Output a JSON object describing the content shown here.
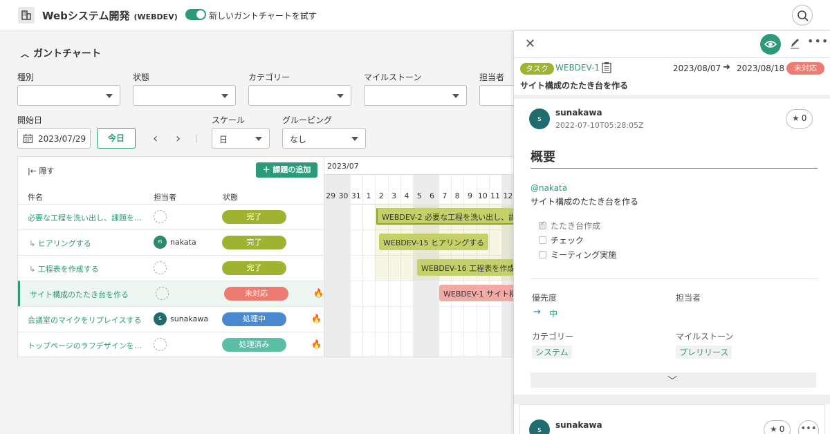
{
  "header": {
    "project_name": "Webシステム開発",
    "project_key": "(WEBDEV)",
    "toggle_label": "新しいガントチャートを試す"
  },
  "gantt_section": {
    "title": "ガントチャート",
    "filters": [
      {
        "label": "種別",
        "value": ""
      },
      {
        "label": "状態",
        "value": ""
      },
      {
        "label": "カテゴリー",
        "value": ""
      },
      {
        "label": "マイルストーン",
        "value": ""
      },
      {
        "label": "担当者",
        "value": ""
      }
    ],
    "start_date_label": "開始日",
    "start_date": "2023/07/29",
    "today_button": "今日",
    "scale_label": "スケール",
    "scale_value": "日",
    "grouping_label": "グルーピング",
    "grouping_value": "なし",
    "hide_label": "隠す",
    "add_issue_button": "課題の追加",
    "columns": {
      "name": "件名",
      "assignee": "担当者",
      "status": "状態"
    },
    "timeline_month": "2023/07",
    "timeline_days": [
      "29",
      "30",
      "31",
      "1",
      "2",
      "3",
      "4",
      "5",
      "6",
      "7",
      "8",
      "9",
      "10",
      "11",
      "12"
    ],
    "rows": [
      {
        "name": "必要な工程を洗い出し、課題を…",
        "subtask": false,
        "assignee": "",
        "assignee_initial": "",
        "status": "完了",
        "status_color": "#a0b330",
        "hot": false
      },
      {
        "name": "ヒアリングする",
        "subtask": true,
        "assignee": "nakata",
        "assignee_initial": "n",
        "status": "完了",
        "status_color": "#a0b330",
        "hot": false
      },
      {
        "name": "工程表を作成する",
        "subtask": true,
        "assignee": "",
        "assignee_initial": "",
        "status": "完了",
        "status_color": "#a0b330",
        "hot": false
      },
      {
        "name": "サイト構成のたたき台を作る",
        "subtask": false,
        "assignee": "",
        "assignee_initial": "",
        "status": "未対応",
        "status_color": "#ee7b73",
        "hot": true
      },
      {
        "name": "会議室のマイクをリプレイスする",
        "subtask": false,
        "assignee": "sunakawa",
        "assignee_initial": "s",
        "status": "処理中",
        "status_color": "#4a88d0",
        "hot": true
      },
      {
        "name": "トップページのラフデザインを…",
        "subtask": false,
        "assignee": "",
        "assignee_initial": "",
        "status": "処理済み",
        "status_color": "#5bbfa8",
        "hot": true
      }
    ],
    "bars": [
      {
        "label": "WEBDEV-2  必要な工程を洗い出し、課",
        "color": "#c5d168"
      },
      {
        "label": "WEBDEV-15  ヒアリングする",
        "color": "#c5d168"
      },
      {
        "label": "WEBDEV-16  工程表を作成",
        "color": "#c5d168"
      },
      {
        "label": "WEBDEV-1  サイト構",
        "color": "#f3aaa5"
      }
    ]
  },
  "detail_panel": {
    "issue_type": "タスク",
    "issue_key": "WEBDEV-1",
    "start_date": "2023/08/07",
    "end_date": "2023/08/18",
    "status": "未対応",
    "title": "サイト構成のたたき台を作る",
    "comment": {
      "user": "sunakawa",
      "avatar_initial": "s",
      "timestamp": "2022-07-10T05:28:05Z",
      "star_count": "0"
    },
    "description_title": "概要",
    "mention": "@nakata",
    "description_text": "サイト構成のたたき台を作る",
    "checklist": [
      {
        "label": "たたき台作成",
        "checked": true
      },
      {
        "label": "チェック",
        "checked": false
      },
      {
        "label": "ミーティング実施",
        "checked": false
      }
    ],
    "attributes": {
      "priority_label": "優先度",
      "priority_value": "中",
      "assignee_label": "担当者",
      "category_label": "カテゴリー",
      "category_value": "システム",
      "milestone_label": "マイルストーン",
      "milestone_value": "プレリリース"
    },
    "comment2": {
      "user": "sunakawa",
      "avatar_initial": "s",
      "star_count": "0"
    }
  }
}
